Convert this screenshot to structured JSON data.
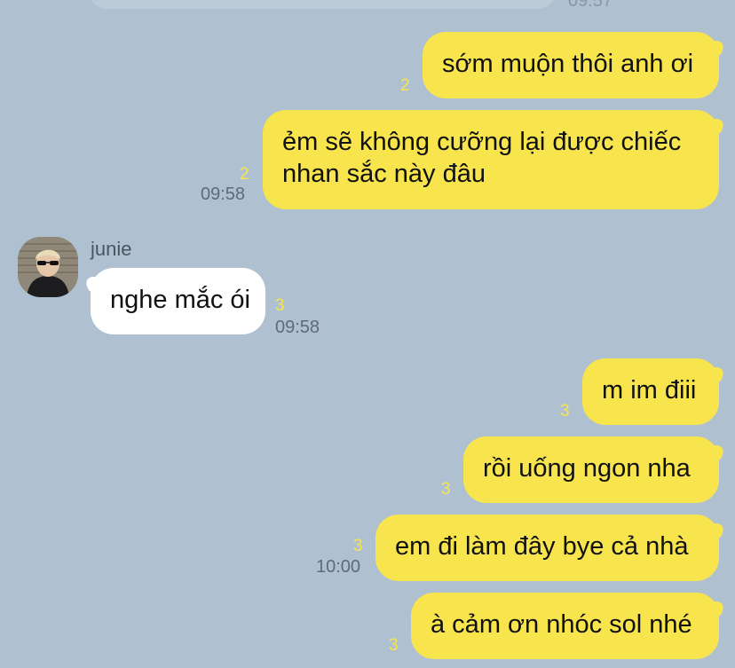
{
  "chat": {
    "prev_time": "09:57",
    "messages": [
      {
        "side": "me",
        "text": "sớm muộn thôi anh ơi",
        "read": "2",
        "time": ""
      },
      {
        "side": "me",
        "text": "ẻm sẽ không cưỡng lại được chiếc nhan sắc này đâu",
        "read": "2",
        "time": "09:58"
      },
      {
        "side": "them",
        "sender": "junie",
        "text": "nghe mắc ói",
        "read": "3",
        "time": "09:58"
      },
      {
        "side": "me",
        "text": "m im điii",
        "read": "3",
        "time": ""
      },
      {
        "side": "me",
        "text": "rồi uống ngon nha",
        "read": "3",
        "time": ""
      },
      {
        "side": "me",
        "text": "em đi làm đây bye cả nhà",
        "read": "3",
        "time": "10:00"
      },
      {
        "side": "me",
        "text": "à cảm ơn nhóc sol nhé",
        "read": "3",
        "time": ""
      }
    ]
  },
  "colors": {
    "background": "#afc0d0",
    "my_bubble": "#f8e54e",
    "their_bubble": "#ffffff",
    "read_count": "#f8e54e"
  },
  "icons": {
    "avatar": "avatar-photo"
  }
}
